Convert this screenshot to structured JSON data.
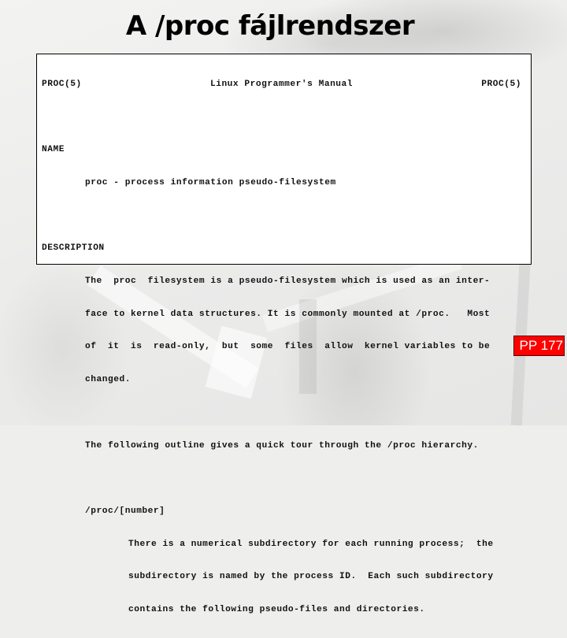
{
  "slide": {
    "title": "A /proc fájlrendszer",
    "badge": "PP 177",
    "accent_color": "#ff0000"
  },
  "manpage": {
    "header": {
      "left": "PROC(5)",
      "center": "Linux Programmer's Manual",
      "right": "PROC(5)"
    },
    "name_section": {
      "heading": "NAME",
      "text": "proc - process information pseudo-filesystem"
    },
    "description_section": {
      "heading": "DESCRIPTION",
      "paragraph1": [
        "The  proc  filesystem is a pseudo-filesystem which is used as an inter-",
        "face to kernel data structures. It is commonly mounted at /proc.   Most",
        "of  it  is  read-only,  but  some  files  allow  kernel variables to be",
        "changed."
      ],
      "paragraph2": "The following outline gives a quick tour through the /proc hierarchy.",
      "entry": {
        "term": "/proc/[number]",
        "lines": [
          "There is a numerical subdirectory for each running process;  the",
          "subdirectory is named by the process ID.  Each such subdirectory",
          "contains the following pseudo-files and directories."
        ]
      }
    }
  }
}
